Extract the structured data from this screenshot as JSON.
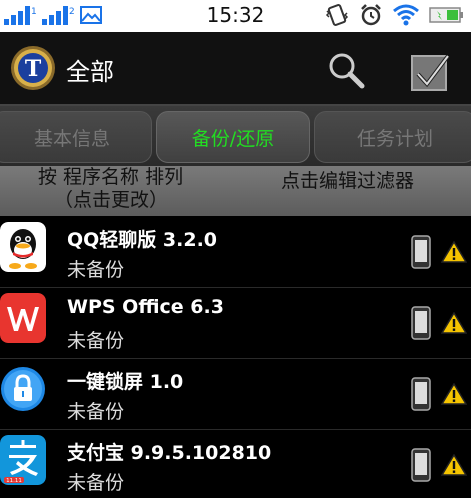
{
  "status_bar": {
    "time": "15:32",
    "left_icons": [
      "signal-icon",
      "signal-icon",
      "image-icon"
    ],
    "right_icons": [
      "vibrate-icon",
      "alarm-icon",
      "wifi-icon",
      "battery-icon"
    ]
  },
  "action_bar": {
    "title": "全部",
    "logo_letter": "T",
    "icons": [
      "search-icon",
      "check-select-icon"
    ]
  },
  "tabs": [
    {
      "label": "基本信息",
      "active": false
    },
    {
      "label": "备份/还原",
      "active": true
    },
    {
      "label": "任务计划",
      "active": false
    }
  ],
  "sort_bar": {
    "sort_line1": "按 程序名称 排列",
    "sort_line2": "（点击更改）",
    "filter_label": "点击编辑过滤器"
  },
  "apps": [
    {
      "name": "QQ轻聊版 3.2.0",
      "status": "未备份",
      "icon": "qq-icon"
    },
    {
      "name": "WPS Office 6.3",
      "status": "未备份",
      "icon": "wps-icon"
    },
    {
      "name": "一键锁屏 1.0",
      "status": "未备份",
      "icon": "lock-icon"
    },
    {
      "name": "支付宝 9.9.5.102810",
      "status": "未备份",
      "icon": "alipay-icon",
      "icon_badge": "11.11"
    }
  ],
  "colors": {
    "active_tab_text": "#22dd22",
    "inactive_tab_text": "#777777",
    "warning": "#f5c400",
    "wps_red": "#e8352f",
    "alipay_blue": "#1296db",
    "lock_blue": "#1e88e5"
  }
}
